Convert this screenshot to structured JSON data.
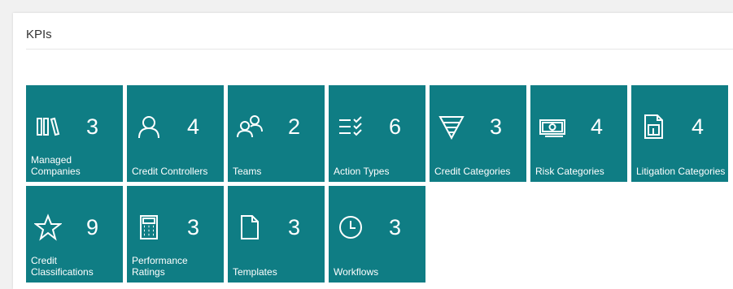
{
  "section": {
    "title": "KPIs"
  },
  "colors": {
    "tile": "#0f7d84",
    "background": "#ffffff"
  },
  "tiles": [
    {
      "label": "Managed Companies",
      "value": "3",
      "icon": "books-icon"
    },
    {
      "label": "Credit Controllers",
      "value": "4",
      "icon": "person-icon"
    },
    {
      "label": "Teams",
      "value": "2",
      "icon": "people-icon"
    },
    {
      "label": "Action Types",
      "value": "6",
      "icon": "checklist-icon"
    },
    {
      "label": "Credit Categories",
      "value": "3",
      "icon": "funnel-icon"
    },
    {
      "label": "Risk Categories",
      "value": "4",
      "icon": "money-icon"
    },
    {
      "label": "Litigation Categories",
      "value": "4",
      "icon": "document-chart-icon"
    },
    {
      "label": "Credit Classifications",
      "value": "9",
      "icon": "star-icon"
    },
    {
      "label": "Performance Ratings",
      "value": "3",
      "icon": "calculator-icon"
    },
    {
      "label": "Templates",
      "value": "3",
      "icon": "page-icon"
    },
    {
      "label": "Workflows",
      "value": "3",
      "icon": "clock-icon"
    }
  ]
}
